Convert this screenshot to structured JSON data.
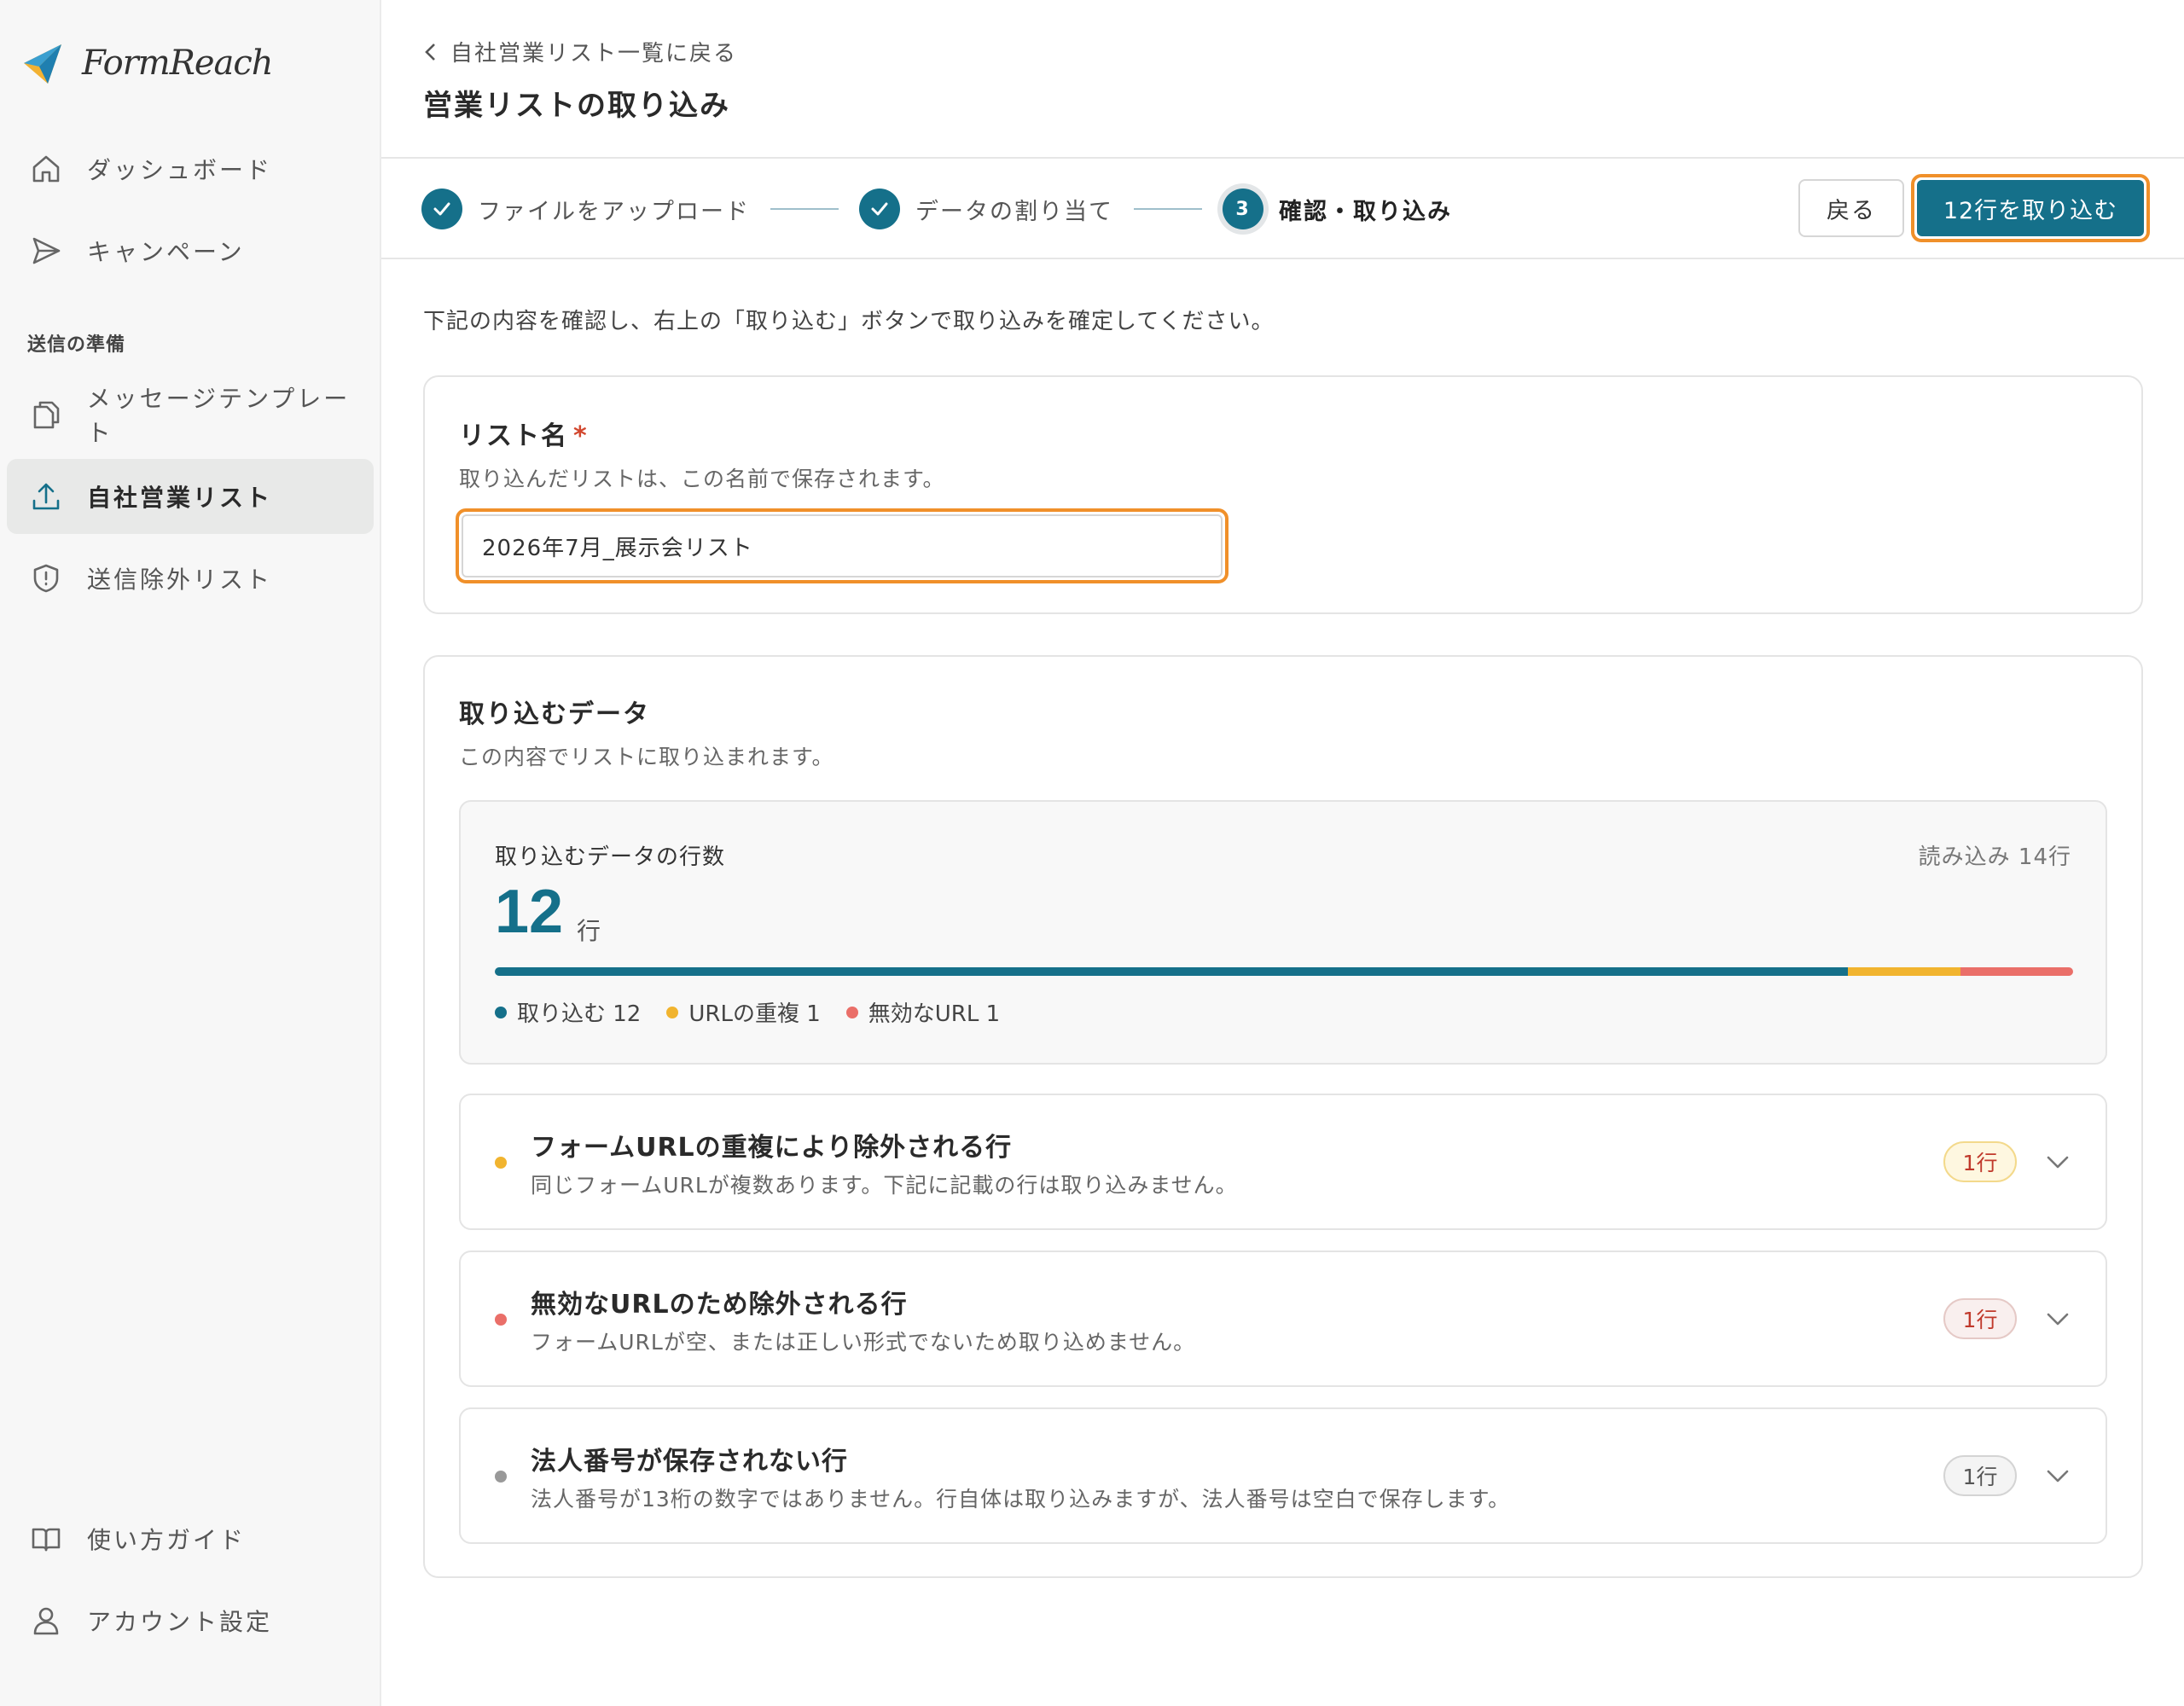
{
  "app": {
    "name": "FormReach"
  },
  "colors": {
    "accent": "#15708a",
    "focus": "#f0902a",
    "import": "#15708a",
    "duplicate": "#f1b42f",
    "invalid": "#ea6f69",
    "neutral": "#999999"
  },
  "sidebar": {
    "items": [
      {
        "label": "ダッシュボード",
        "icon": "home-icon"
      },
      {
        "label": "キャンペーン",
        "icon": "send-icon"
      }
    ],
    "section_label": "送信の準備",
    "prep_items": [
      {
        "label": "メッセージテンプレート",
        "icon": "copy-icon"
      },
      {
        "label": "自社営業リスト",
        "icon": "upload-icon",
        "active": true
      },
      {
        "label": "送信除外リスト",
        "icon": "shield-icon"
      }
    ],
    "bottom_items": [
      {
        "label": "使い方ガイド",
        "icon": "book-icon"
      },
      {
        "label": "アカウント設定",
        "icon": "user-icon"
      }
    ]
  },
  "header": {
    "back_link": "自社営業リスト一覧に戻る",
    "title": "営業リストの取り込み"
  },
  "steps": [
    {
      "label": "ファイルをアップロード",
      "state": "done"
    },
    {
      "label": "データの割り当て",
      "state": "done"
    },
    {
      "label": "確認・取り込み",
      "state": "current",
      "number": "3"
    }
  ],
  "actions": {
    "back": "戻る",
    "primary": "12行を取り込む"
  },
  "intro": "下記の内容を確認し、右上の「取り込む」ボタンで取り込みを確定してください。",
  "list_name": {
    "title": "リスト名",
    "required_mark": "*",
    "help": "取り込んだリストは、この名前で保存されます。",
    "value": "2026年7月_展示会リスト"
  },
  "import_data": {
    "title": "取り込むデータ",
    "help": "この内容でリストに取り込まれます。",
    "summary": {
      "label": "取り込むデータの行数",
      "read_total": "読み込み 14行",
      "count": "12",
      "unit": "行",
      "total_rows": 14,
      "segments": [
        {
          "key": "import",
          "value": 12
        },
        {
          "key": "duplicate",
          "value": 1
        },
        {
          "key": "invalid",
          "value": 1
        }
      ],
      "legend": [
        {
          "label": "取り込む 12",
          "color": "#15708a"
        },
        {
          "label": "URLの重複 1",
          "color": "#f1b42f"
        },
        {
          "label": "無効なURL 1",
          "color": "#ea6f69"
        }
      ]
    },
    "rows": [
      {
        "title": "フォームURLの重複により除外される行",
        "description": "同じフォームURLが複数あります。下記に記載の行は取り込みません。",
        "badge": "1行",
        "color": "#f1b42f",
        "badge_bg": "#fef7e0",
        "badge_border": "#f3d98b",
        "badge_text": "#c0392b"
      },
      {
        "title": "無効なURLのため除外される行",
        "description": "フォームURLが空、または正しい形式でないため取り込めません。",
        "badge": "1行",
        "color": "#ea6f69",
        "badge_bg": "#f9efee",
        "badge_border": "#e5c9c6",
        "badge_text": "#c0392b"
      },
      {
        "title": "法人番号が保存されない行",
        "description": "法人番号が13桁の数字ではありません。行自体は取り込みますが、法人番号は空白で保存します。",
        "badge": "1行",
        "color": "#999999",
        "badge_bg": "#f4f4f4",
        "badge_border": "#d4d4d4",
        "badge_text": "#555555"
      }
    ]
  }
}
